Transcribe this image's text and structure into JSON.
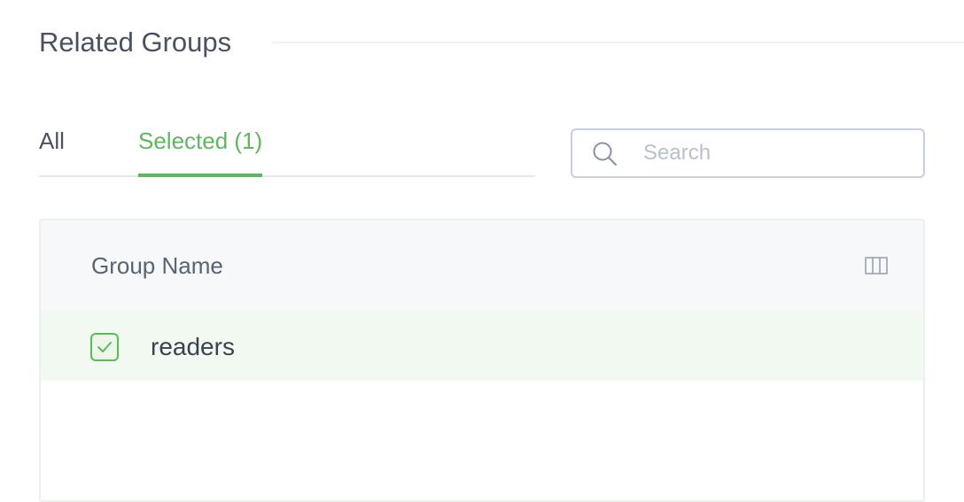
{
  "section": {
    "title": "Related Groups"
  },
  "tabs": [
    {
      "label": "All",
      "active": false
    },
    {
      "label": "Selected (1)",
      "active": true
    }
  ],
  "search": {
    "placeholder": "Search",
    "value": ""
  },
  "table": {
    "columns": [
      "Group Name"
    ],
    "rows": [
      {
        "name": "readers",
        "checked": true
      }
    ]
  },
  "icons": {
    "search": "search-icon",
    "columns": "columns-icon",
    "check": "checkmark-icon"
  },
  "colors": {
    "accent": "#5cb85c",
    "row_selected_bg": "#f2f9f0",
    "header_bg": "#f7f8fa",
    "search_border": "#c8cce4"
  }
}
